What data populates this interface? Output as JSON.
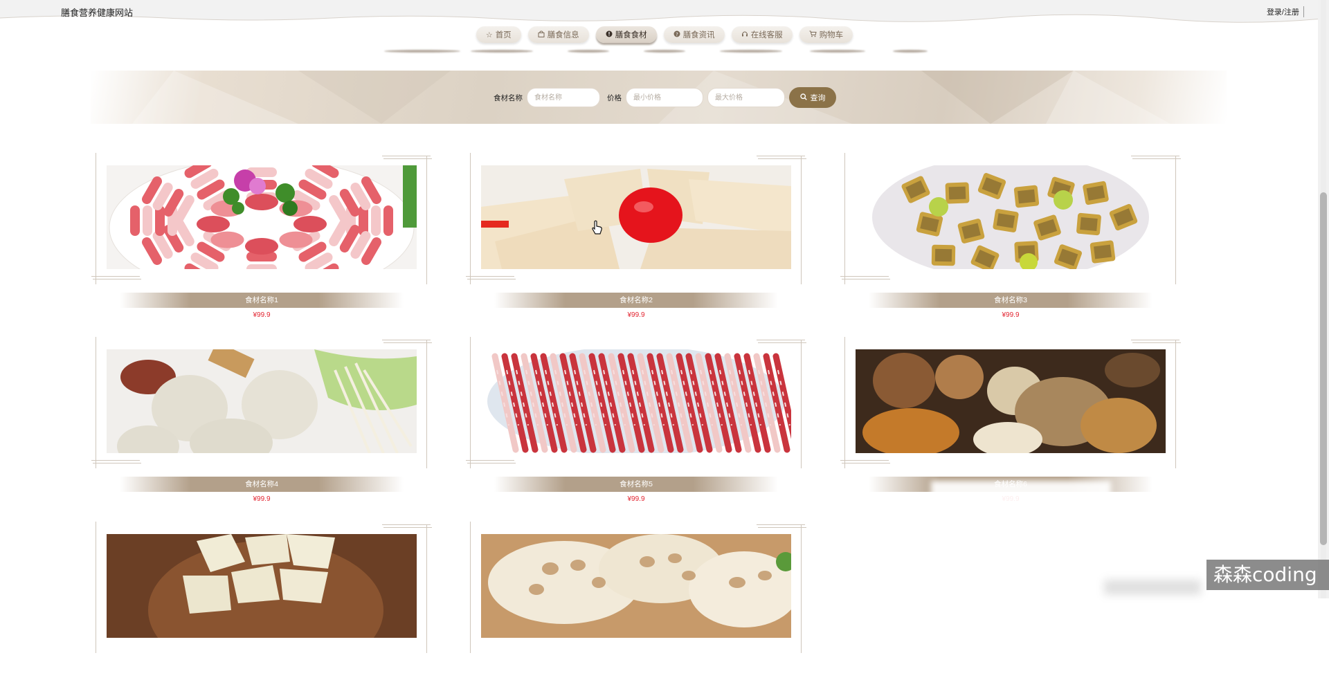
{
  "header": {
    "site_title": "膳食营养健康网站",
    "login_link": "登录/注册"
  },
  "nav": [
    {
      "label": "首页",
      "icon": "star-icon",
      "active": false
    },
    {
      "label": "膳食信息",
      "icon": "bag-icon",
      "active": false
    },
    {
      "label": "膳食食材",
      "icon": "info-icon",
      "active": true
    },
    {
      "label": "膳食资讯",
      "icon": "question-icon",
      "active": false
    },
    {
      "label": "在线客服",
      "icon": "headset-icon",
      "active": false
    },
    {
      "label": "购物车",
      "icon": "cart-icon",
      "active": false
    }
  ],
  "search": {
    "name_label": "食材名称",
    "name_placeholder": "食材名称",
    "price_label": "价格",
    "min_price_placeholder": "最小价格",
    "max_price_placeholder": "最大价格",
    "button_label": "查询",
    "button_icon": "search-icon"
  },
  "products": [
    {
      "name": "食材名称1",
      "price": "¥99.9",
      "image": "sliced-lamb-platter"
    },
    {
      "name": "食材名称2",
      "price": "¥99.9",
      "image": "tofu-slices-with-tomato"
    },
    {
      "name": "食材名称3",
      "price": "¥99.9",
      "image": "eel-segments-with-lime"
    },
    {
      "name": "食材名称4",
      "price": "¥99.9",
      "image": "fish-balls-with-enoki"
    },
    {
      "name": "食材名称5",
      "price": "¥99.9",
      "image": "sliced-sausage"
    },
    {
      "name": "食材名称6",
      "price": "¥99.9",
      "image": "dried-mushrooms"
    },
    {
      "name": "",
      "price": "",
      "image": "tofu-cubes-on-board"
    },
    {
      "name": "",
      "price": "",
      "image": "lotus-root-slices"
    }
  ],
  "watermark": "森森coding"
}
